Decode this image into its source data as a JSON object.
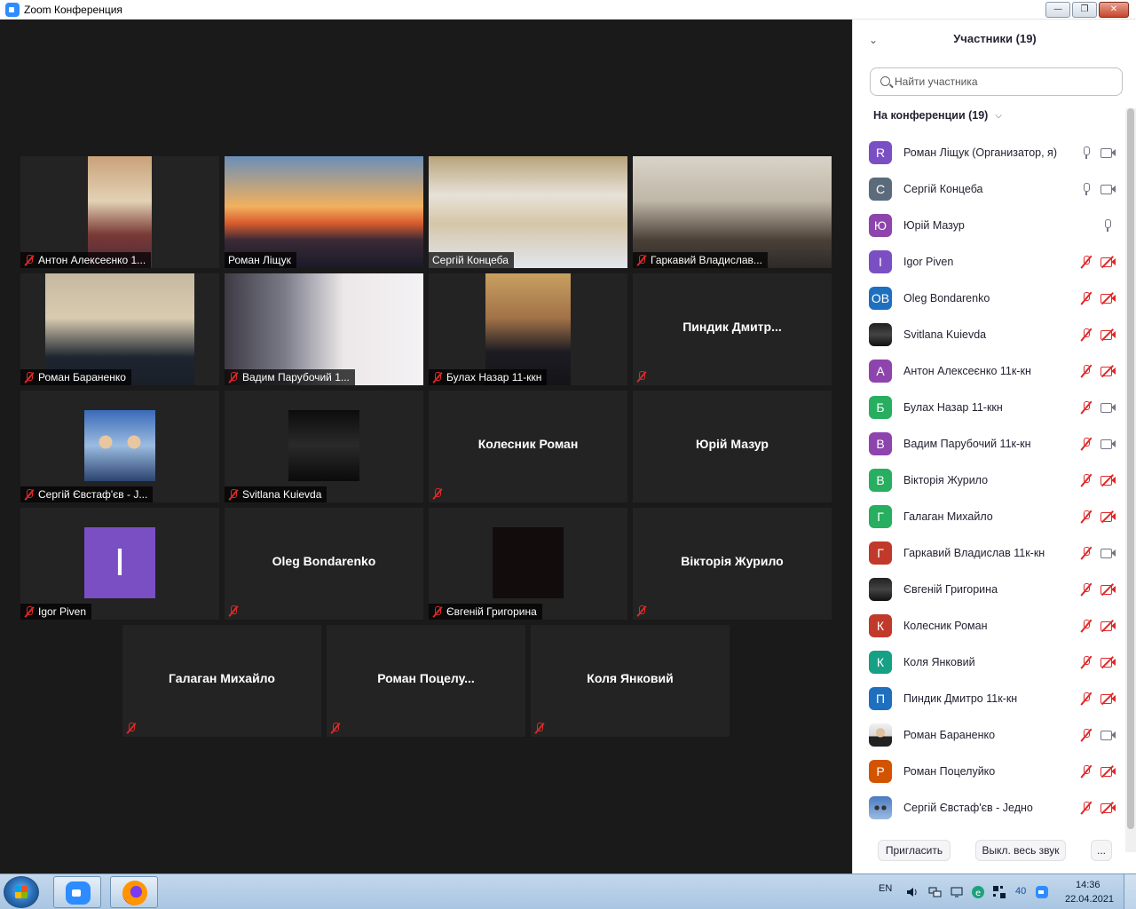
{
  "window": {
    "title": "Zoom Конференция",
    "controls": [
      "minimize",
      "maximize",
      "close"
    ]
  },
  "gallery": {
    "tiles": [
      {
        "name": "Антон Алексеєнко 1...",
        "muted": true,
        "video": "pic-room"
      },
      {
        "name": "Роман Ліщук",
        "muted": false,
        "active": true,
        "video": "pic-golden"
      },
      {
        "name": "Сергій Концеба",
        "muted": false,
        "video": "pic-white"
      },
      {
        "name": "Гаркавий Владислав...",
        "muted": true,
        "video": "pic-grey"
      },
      {
        "name": "Роман Бараненко",
        "muted": true,
        "video": "pic-office"
      },
      {
        "name": "Вадим Парубочий 1...",
        "muted": true,
        "video": "pic-curtain"
      },
      {
        "name": "Булах Назар 11-ккн",
        "muted": true,
        "video": "pic-boy"
      },
      {
        "center_name": "Пиндик  Дмитр...",
        "muted": true
      },
      {
        "name": "Сергій Євстаф'єв - J...",
        "muted": true,
        "video": "pic-cat"
      },
      {
        "name": "Svitlana Kuievda",
        "muted": true,
        "video": "pic-dark"
      },
      {
        "center_name": "Колесник Роман",
        "muted": true
      },
      {
        "center_name": "Юрій Мазур",
        "muted": false
      },
      {
        "name": "Igor Piven",
        "muted": true,
        "video": "pic-purple",
        "avatar_letter": "I"
      },
      {
        "center_name": "Oleg Bondarenko",
        "muted": true
      },
      {
        "name": "Євгеній Григорина",
        "muted": true,
        "video": "pic-black"
      },
      {
        "center_name": "Вікторія Журило",
        "muted": true
      },
      {
        "center_name": "Галаган Михайло",
        "muted": true
      },
      {
        "center_name": "Роман  Поцелу...",
        "muted": true
      },
      {
        "center_name": "Коля Янковий",
        "muted": true
      }
    ]
  },
  "sidebar": {
    "title": "Участники (19)",
    "search_placeholder": "Найти участника",
    "section_label": "На конференции (19)",
    "participants": [
      {
        "name": "Роман Ліщук (Организатор, я)",
        "avatar": "R",
        "color": "#7b4fc4",
        "mic": "on",
        "cam": "on"
      },
      {
        "name": "Сергій Концеба",
        "avatar": "C",
        "color": "#5b6b7b",
        "mic": "on",
        "cam": "on"
      },
      {
        "name": "Юрій Мазур",
        "avatar": "Ю",
        "color": "#8e44ad",
        "mic": "on",
        "cam": "none"
      },
      {
        "name": "Igor Piven",
        "avatar": "I",
        "color": "#7b4fc4",
        "mic": "muted",
        "cam": "off"
      },
      {
        "name": "Oleg Bondarenko",
        "avatar": "OB",
        "color": "#1f6fbf",
        "mic": "muted",
        "cam": "off"
      },
      {
        "name": "Svitlana Kuievda",
        "avatar": "",
        "avatar_image": "img",
        "color": "#222222",
        "mic": "muted",
        "cam": "off"
      },
      {
        "name": "Антон Алексеєнко 11к-кн",
        "avatar": "А",
        "color": "#8e44ad",
        "mic": "muted",
        "cam": "off"
      },
      {
        "name": "Булах Назар 11-ккн",
        "avatar": "Б",
        "color": "#27ae60",
        "mic": "muted",
        "cam": "on"
      },
      {
        "name": "Вадим Парубочий 11к-кн",
        "avatar": "В",
        "color": "#8e44ad",
        "mic": "muted",
        "cam": "on"
      },
      {
        "name": "Вікторія Журило",
        "avatar": "В",
        "color": "#27ae60",
        "mic": "muted",
        "cam": "off"
      },
      {
        "name": "Галаган Михайло",
        "avatar": "Г",
        "color": "#27ae60",
        "mic": "muted",
        "cam": "off"
      },
      {
        "name": "Гаркавий Владислав 11к-кн",
        "avatar": "Г",
        "color": "#c0392b",
        "mic": "muted",
        "cam": "on"
      },
      {
        "name": "Євгеній Григорина",
        "avatar": "",
        "avatar_image": "img",
        "color": "#111111",
        "mic": "muted",
        "cam": "off"
      },
      {
        "name": "Колесник Роман",
        "avatar": "К",
        "color": "#c0392b",
        "mic": "muted",
        "cam": "off"
      },
      {
        "name": "Коля Янковий",
        "avatar": "К",
        "color": "#16a085",
        "mic": "muted",
        "cam": "off"
      },
      {
        "name": "Пиндик Дмитро 11к-кн",
        "avatar": "П",
        "color": "#1f6fbf",
        "mic": "muted",
        "cam": "off"
      },
      {
        "name": "Роман Бараненко",
        "avatar": "",
        "avatar_image": "img-man",
        "color": "#dddddd",
        "mic": "muted",
        "cam": "on"
      },
      {
        "name": "Роман Поцелуйко",
        "avatar": "Р",
        "color": "#d35400",
        "mic": "muted",
        "cam": "off"
      },
      {
        "name": "Сергій Євстаф'єв - Jедно",
        "avatar": "",
        "avatar_image": "img-cat",
        "color": "#4a7ac0",
        "mic": "muted",
        "cam": "off"
      }
    ],
    "buttons": {
      "invite": "Пригласить",
      "mute_all": "Выкл. весь звук",
      "more": "..."
    }
  },
  "taskbar": {
    "apps": [
      "Zoom",
      "Firefox"
    ],
    "lang": "EN",
    "time": "14:36",
    "date": "22.04.2021",
    "tray_badge": "40"
  }
}
